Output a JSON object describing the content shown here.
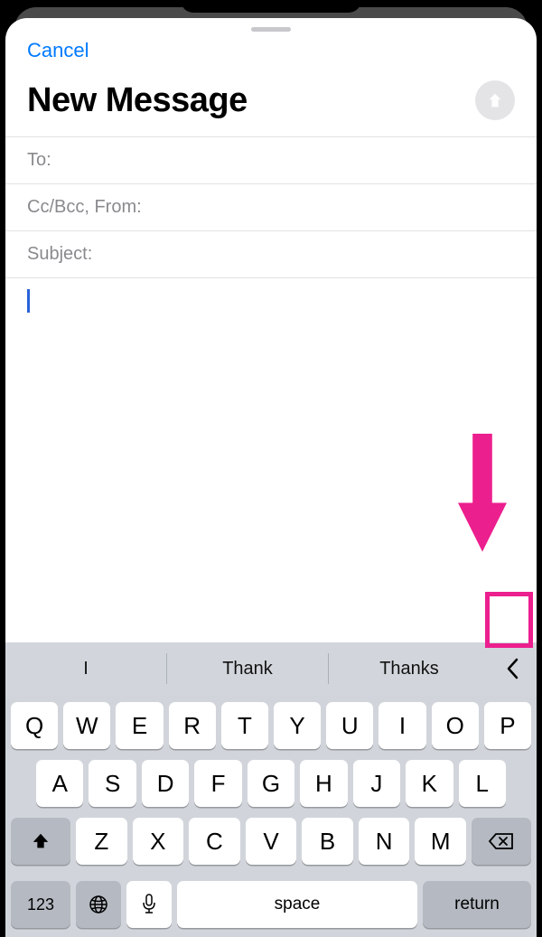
{
  "header": {
    "cancel_label": "Cancel",
    "title": "New Message"
  },
  "fields": {
    "to_label": "To:",
    "ccbcc_label": "Cc/Bcc, From:",
    "subject_label": "Subject:"
  },
  "keyboard": {
    "suggestions": [
      "I",
      "Thank",
      "Thanks"
    ],
    "row1": [
      "Q",
      "W",
      "E",
      "R",
      "T",
      "Y",
      "U",
      "I",
      "O",
      "P"
    ],
    "row2": [
      "A",
      "S",
      "D",
      "F",
      "G",
      "H",
      "J",
      "K",
      "L"
    ],
    "row3": [
      "Z",
      "X",
      "C",
      "V",
      "B",
      "N",
      "M"
    ],
    "numeric_label": "123",
    "space_label": "space",
    "return_label": "return"
  }
}
